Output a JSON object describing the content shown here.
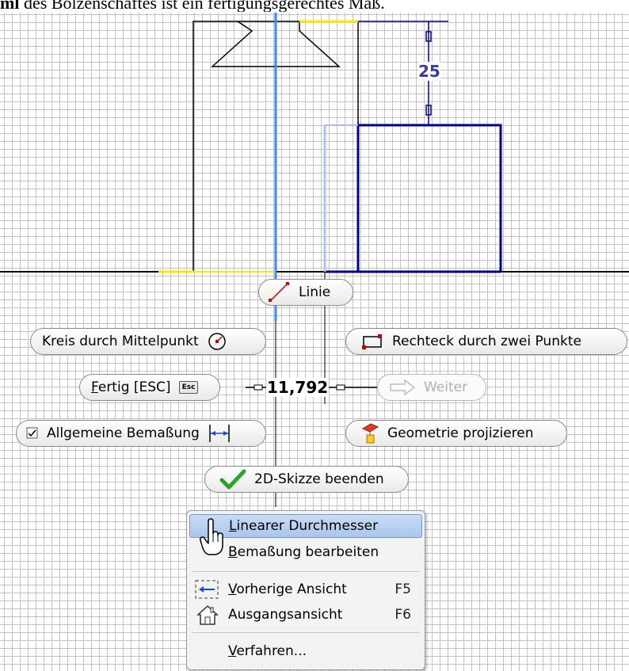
{
  "caption": {
    "bold": "ml",
    "rest": " des Bolzenschaftes ist ein fertigungsgerechtes Maß."
  },
  "dimensions": {
    "vertical": "25",
    "input": "11,792"
  },
  "buttons": {
    "linie": "Linie",
    "kreis": "Kreis durch Mittelpunkt",
    "rechteck": "Rechteck durch zwei Punkte",
    "fertig": "Fertig [ESC]",
    "fertig_key": "Esc",
    "weiter": "Weiter",
    "bemassung": "Allgemeine Bemaßung",
    "geometrie": "Geometrie projizieren",
    "skizze_beenden": "2D-Skizze beenden"
  },
  "context_menu": {
    "items": [
      {
        "label": "Linearer Durchmesser",
        "shortcut": ""
      },
      {
        "label": "Bemaßung bearbeiten",
        "shortcut": ""
      },
      {
        "label": "Vorherige Ansicht",
        "shortcut": "F5"
      },
      {
        "label": "Ausgangsansicht",
        "shortcut": "F6"
      },
      {
        "label": "Verfahren...",
        "shortcut": ""
      }
    ]
  },
  "colors": {
    "selected_geometry": "#00008c",
    "centerline": "#3c8cff",
    "constraint": "#ffe800",
    "menu_highlight": "#aac6ec",
    "check_green": "#2aa52a"
  },
  "icons": {
    "linie": "line-icon",
    "kreis": "circle-center-icon",
    "rechteck": "rectangle-icon",
    "weiter": "arrow-right-icon",
    "bemassung": "dimension-icon",
    "geometrie": "project-geometry-icon",
    "beenden": "checkmark-icon",
    "cursor": "hand-cursor-icon"
  }
}
